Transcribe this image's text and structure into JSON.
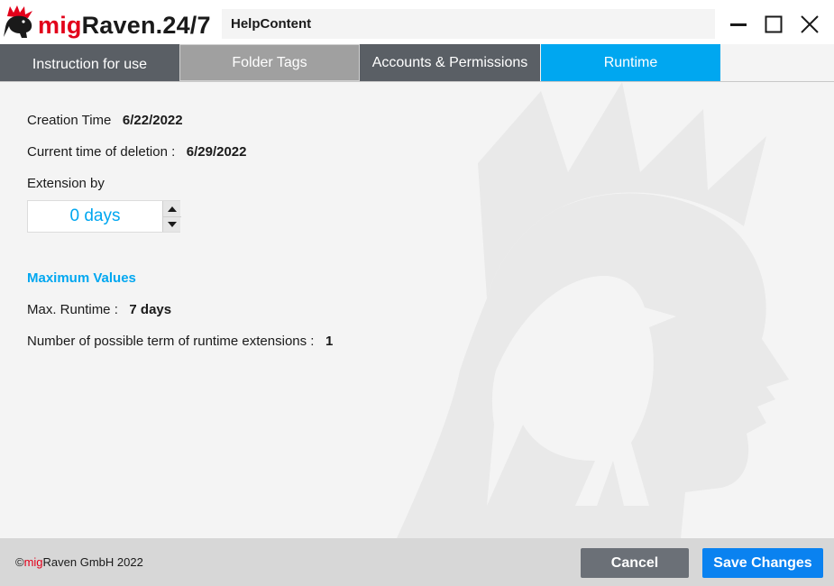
{
  "app": {
    "logo_prefix": "mig",
    "logo_suffix": "Raven.24/7",
    "window_title": "HelpContent"
  },
  "window_controls": {
    "minimize_icon": "minimize-icon",
    "maximize_icon": "maximize-icon",
    "close_icon": "close-icon"
  },
  "tabs": [
    {
      "label": "Instruction for use",
      "active": false
    },
    {
      "label": "Folder Tags",
      "active": false
    },
    {
      "label": "Accounts & Permissions",
      "active": false
    },
    {
      "label": "Runtime",
      "active": true
    }
  ],
  "runtime": {
    "creation_label": "Creation Time",
    "creation_value": "6/22/2022",
    "deletion_label": "Current time of deletion :",
    "deletion_value": "6/29/2022",
    "extension_label": "Extension by",
    "extension_value": "0 days",
    "max_section_title": "Maximum Values",
    "max_runtime_label": "Max. Runtime :",
    "max_runtime_value": "7 days",
    "num_extensions_label": "Number of possible term of runtime extensions :",
    "num_extensions_value": "1"
  },
  "footer": {
    "copyright_symbol": "©",
    "copyright_brand": "mig",
    "copyright_rest": "Raven GmbH 2022",
    "cancel_label": "Cancel",
    "save_label": "Save Changes"
  },
  "colors": {
    "accent": "#00a7f0",
    "brand_red": "#e2001a",
    "tab_dark": "#5a5f65",
    "tab_grey": "#a0a0a0",
    "save_button": "#0a82f0",
    "cancel_button": "#6b7077"
  }
}
